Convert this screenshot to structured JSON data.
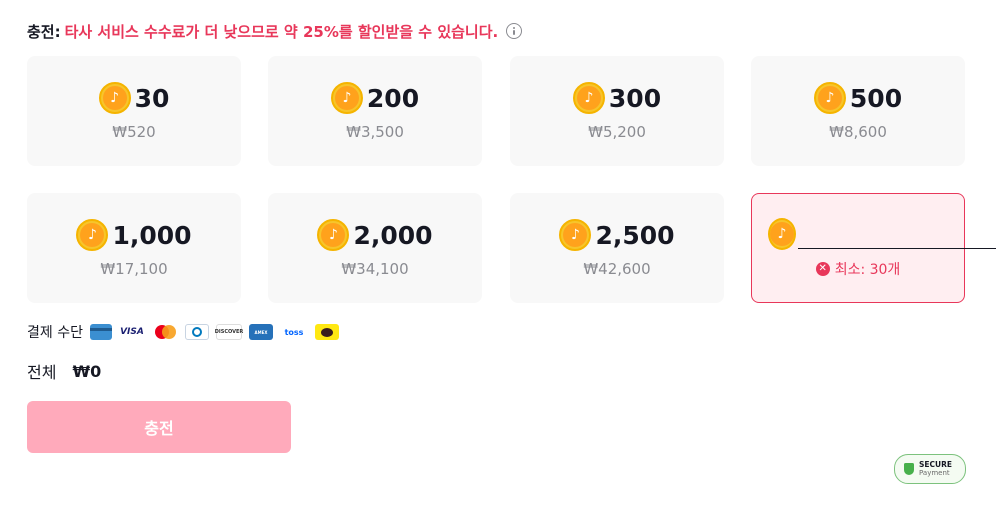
{
  "header": {
    "label": "충전:",
    "promo": "타사 서비스 수수료가 더 낮으므로 약 25%를 할인받을 수 있습니다."
  },
  "coin_icon": "tiktok-coin-icon",
  "packages": [
    {
      "amount": "30",
      "price": "₩520"
    },
    {
      "amount": "200",
      "price": "₩3,500"
    },
    {
      "amount": "300",
      "price": "₩5,200"
    },
    {
      "amount": "500",
      "price": "₩8,600"
    },
    {
      "amount": "1,000",
      "price": "₩17,100"
    },
    {
      "amount": "2,000",
      "price": "₩34,100"
    },
    {
      "amount": "2,500",
      "price": "₩42,600"
    }
  ],
  "custom": {
    "value": "",
    "placeholder": "",
    "min_text": "최소: 30개"
  },
  "payment": {
    "label": "결제 수단",
    "methods": [
      "card",
      "VISA",
      "mastercard",
      "diners",
      "DISCOVER",
      "AMERICAN EXPRESS",
      "toss",
      "kakaopay"
    ]
  },
  "total": {
    "label": "전체",
    "value": "₩0"
  },
  "charge_button": "충전",
  "secure": {
    "line1": "SECURE",
    "line2": "Payment"
  },
  "colors": {
    "accent": "#e8375a",
    "button_disabled": "#ffaabb",
    "card_bg": "#f8f8f8",
    "coin": "#f7c52b"
  }
}
